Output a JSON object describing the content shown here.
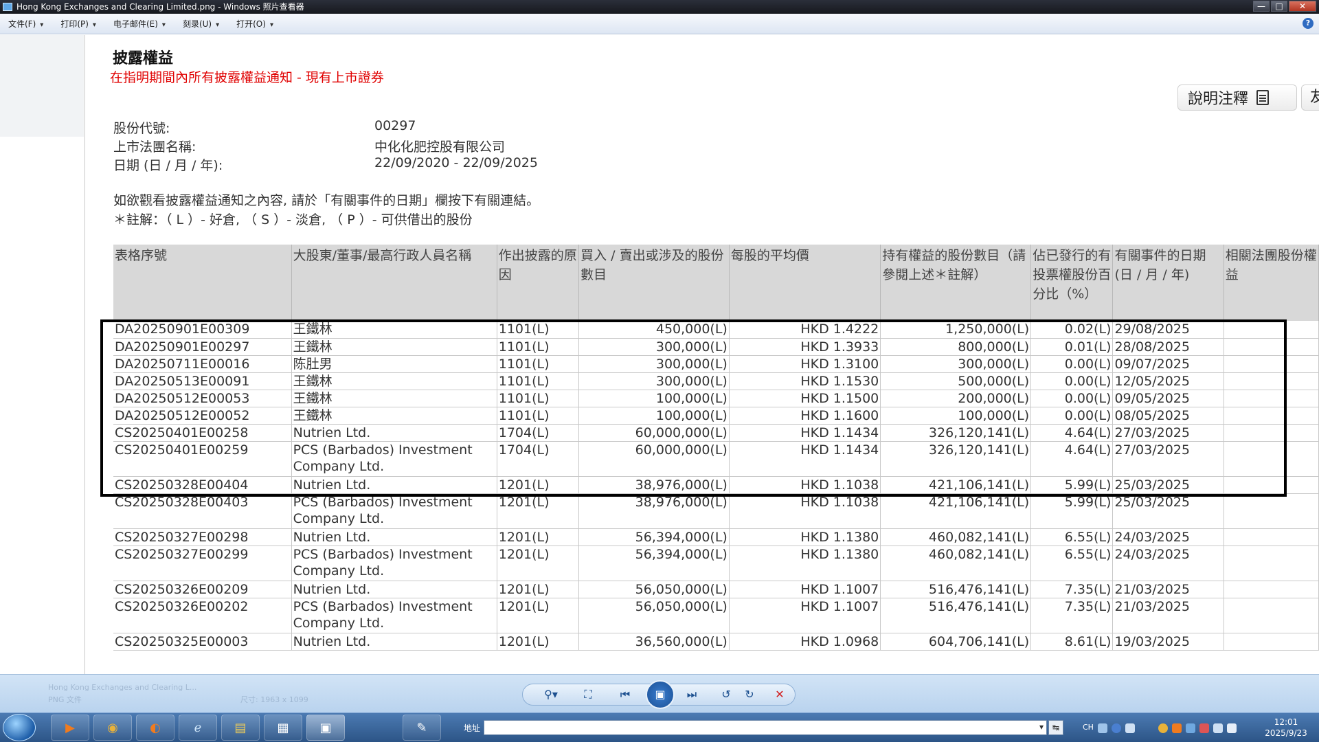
{
  "window": {
    "title": "Hong Kong Exchanges and Clearing Limited.png - Windows 照片查看器",
    "controls": {
      "minimize": "—",
      "maximize": "□",
      "close": "✕"
    }
  },
  "menubar": {
    "items": [
      "文件(F)",
      "打印(P)",
      "电子邮件(E)",
      "刻录(U)",
      "打开(O)"
    ],
    "help_icon": "?"
  },
  "page": {
    "title": "披露權益",
    "subtitle": "在指明期間內所有披露權益通知 - 現有上市證券",
    "notes_button": "說明注釋",
    "next_button": "友",
    "info": {
      "stock_code_label": "股份代號:",
      "stock_code": "00297",
      "company_label": "上市法團名稱:",
      "company": "中化化肥控股有限公司",
      "date_label": "日期 (日 / 月 / 年):",
      "date_range": "22/09/2020 - 22/09/2025"
    },
    "instruction_1": "如欲觀看披露權益通知之內容, 請於「有關事件的日期」欄按下有關連結。",
    "instruction_2": "＊註解：（ L ）- 好倉, （ S ）- 淡倉, （ P ）- 可供借出的股份"
  },
  "table": {
    "headers": [
      "表格序號",
      "大股東/董事/最高行政人員名稱",
      "作出披露的原因",
      "買入 / 賣出或涉及的股份數目",
      "每股的平均價",
      "持有權益的股份數目（請參閱上述＊註解）",
      "佔已發行的有投票權股份百分比（%）",
      "有關事件的日期(日 / 月 / 年)",
      "相關法團股份權益"
    ],
    "rows": [
      {
        "form": "DA20250901E00309",
        "name": "王鐵林",
        "reason": "1101(L)",
        "shares": "450,000(L)",
        "price": "HKD 1.4222",
        "holding": "1,250,000(L)",
        "pct": "0.02(L)",
        "date": "29/08/2025"
      },
      {
        "form": "DA20250901E00297",
        "name": "王鐵林",
        "reason": "1101(L)",
        "shares": "300,000(L)",
        "price": "HKD 1.3933",
        "holding": "800,000(L)",
        "pct": "0.01(L)",
        "date": "28/08/2025"
      },
      {
        "form": "DA20250711E00016",
        "name": "陈肚男",
        "reason": "1101(L)",
        "shares": "300,000(L)",
        "price": "HKD 1.3100",
        "holding": "300,000(L)",
        "pct": "0.00(L)",
        "date": "09/07/2025"
      },
      {
        "form": "DA20250513E00091",
        "name": "王鐵林",
        "reason": "1101(L)",
        "shares": "300,000(L)",
        "price": "HKD 1.1530",
        "holding": "500,000(L)",
        "pct": "0.00(L)",
        "date": "12/05/2025"
      },
      {
        "form": "DA20250512E00053",
        "name": "王鐵林",
        "reason": "1101(L)",
        "shares": "100,000(L)",
        "price": "HKD 1.1500",
        "holding": "200,000(L)",
        "pct": "0.00(L)",
        "date": "09/05/2025"
      },
      {
        "form": "DA20250512E00052",
        "name": "王鐵林",
        "reason": "1101(L)",
        "shares": "100,000(L)",
        "price": "HKD 1.1600",
        "holding": "100,000(L)",
        "pct": "0.00(L)",
        "date": "08/05/2025"
      },
      {
        "form": "CS20250401E00258",
        "name": "Nutrien Ltd.",
        "reason": "1704(L)",
        "shares": "60,000,000(L)",
        "price": "HKD 1.1434",
        "holding": "326,120,141(L)",
        "pct": "4.64(L)",
        "date": "27/03/2025"
      },
      {
        "form": "CS20250401E00259",
        "name": "PCS (Barbados) Investment Company Ltd.",
        "reason": "1704(L)",
        "shares": "60,000,000(L)",
        "price": "HKD 1.1434",
        "holding": "326,120,141(L)",
        "pct": "4.64(L)",
        "date": "27/03/2025"
      },
      {
        "form": "CS20250328E00404",
        "name": "Nutrien Ltd.",
        "reason": "1201(L)",
        "shares": "38,976,000(L)",
        "price": "HKD 1.1038",
        "holding": "421,106,141(L)",
        "pct": "5.99(L)",
        "date": "25/03/2025"
      },
      {
        "form": "CS20250328E00403",
        "name": "PCS (Barbados) Investment Company Ltd.",
        "reason": "1201(L)",
        "shares": "38,976,000(L)",
        "price": "HKD 1.1038",
        "holding": "421,106,141(L)",
        "pct": "5.99(L)",
        "date": "25/03/2025"
      },
      {
        "form": "CS20250327E00298",
        "name": "Nutrien Ltd.",
        "reason": "1201(L)",
        "shares": "56,394,000(L)",
        "price": "HKD 1.1380",
        "holding": "460,082,141(L)",
        "pct": "6.55(L)",
        "date": "24/03/2025"
      },
      {
        "form": "CS20250327E00299",
        "name": "PCS (Barbados) Investment Company Ltd.",
        "reason": "1201(L)",
        "shares": "56,394,000(L)",
        "price": "HKD 1.1380",
        "holding": "460,082,141(L)",
        "pct": "6.55(L)",
        "date": "24/03/2025"
      },
      {
        "form": "CS20250326E00209",
        "name": "Nutrien Ltd.",
        "reason": "1201(L)",
        "shares": "56,050,000(L)",
        "price": "HKD 1.1007",
        "holding": "516,476,141(L)",
        "pct": "7.35(L)",
        "date": "21/03/2025"
      },
      {
        "form": "CS20250326E00202",
        "name": "PCS (Barbados) Investment Company Ltd.",
        "reason": "1201(L)",
        "shares": "56,050,000(L)",
        "price": "HKD 1.1007",
        "holding": "516,476,141(L)",
        "pct": "7.35(L)",
        "date": "21/03/2025"
      },
      {
        "form": "CS20250325E00003",
        "name": "Nutrien Ltd.",
        "reason": "1201(L)",
        "shares": "36,560,000(L)",
        "price": "HKD 1.0968",
        "holding": "604,706,141(L)",
        "pct": "8.61(L)",
        "date": "19/03/2025"
      }
    ]
  },
  "viewer_toolbar": {
    "faint_file": "Hong Kong Exchanges and Clearing L...",
    "faint_type": "PNG 文件",
    "faint_dims": "尺寸: 1963 x 1099",
    "tools": {
      "zoom": "⚲▾",
      "fit": "⛶",
      "prev": "⏮",
      "slideshow": "▣",
      "next": "⏭",
      "rotate_ccw": "↺",
      "rotate_cw": "↻",
      "delete": "✕"
    }
  },
  "taskbar": {
    "address_label": "地址",
    "address_go": "↹",
    "lang": "CH",
    "time": "12:01",
    "date": "2025/9/23",
    "colors": {
      "chrome": "#e8b23a",
      "media": "#f07b1e",
      "folder": "#f3cf56"
    }
  }
}
